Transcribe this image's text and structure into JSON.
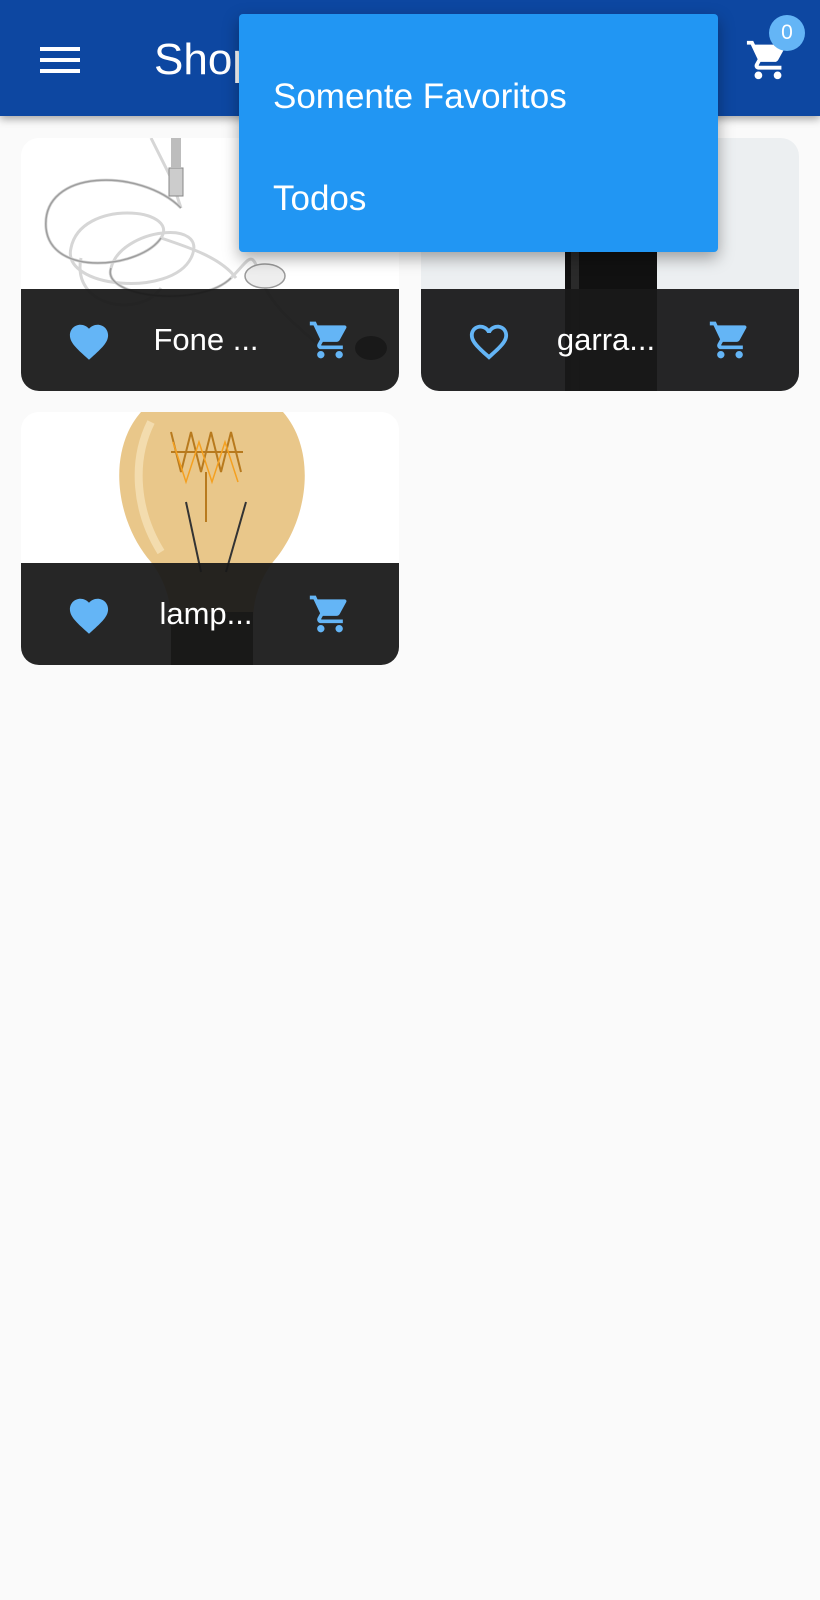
{
  "app_bar": {
    "title": "Shop",
    "menu_icon": "menu-icon",
    "cart_icon": "cart-icon",
    "cart_count": "0",
    "background": "#0d47a1"
  },
  "filter_menu": {
    "items": [
      {
        "label": "Somente Favoritos"
      },
      {
        "label": "Todos"
      }
    ],
    "background": "#2196f3"
  },
  "products": [
    {
      "title": "Fone ...",
      "favorite": true,
      "favorite_icon": "heart-filled-icon",
      "cart_icon": "add-to-cart-icon",
      "image": "earphones"
    },
    {
      "title": "garra...",
      "favorite": false,
      "favorite_icon": "heart-outline-icon",
      "cart_icon": "add-to-cart-icon",
      "image": "bottle"
    },
    {
      "title": "lamp...",
      "favorite": true,
      "favorite_icon": "heart-filled-icon",
      "cart_icon": "add-to-cart-icon",
      "image": "lamp"
    }
  ],
  "colors": {
    "accent": "#64b5f6",
    "page_background": "#fafafa",
    "card_footer": "#181818"
  }
}
